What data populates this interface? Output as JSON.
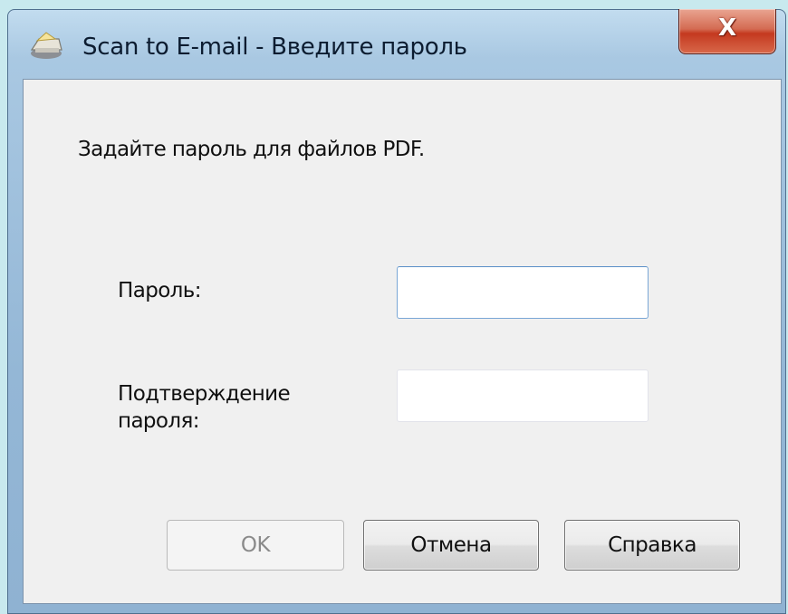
{
  "window": {
    "title": "Scan to E-mail - Введите пароль",
    "icon": "scanner-email-icon",
    "close_label": "X"
  },
  "dialog": {
    "instruction": "Задайте пароль для файлов PDF.",
    "password_label": "Пароль:",
    "password_value": "",
    "confirm_label_line1": "Подтверждение",
    "confirm_label_line2": "пароля:",
    "confirm_value": ""
  },
  "buttons": {
    "ok": "OK",
    "cancel": "Отмена",
    "help": "Справка"
  }
}
